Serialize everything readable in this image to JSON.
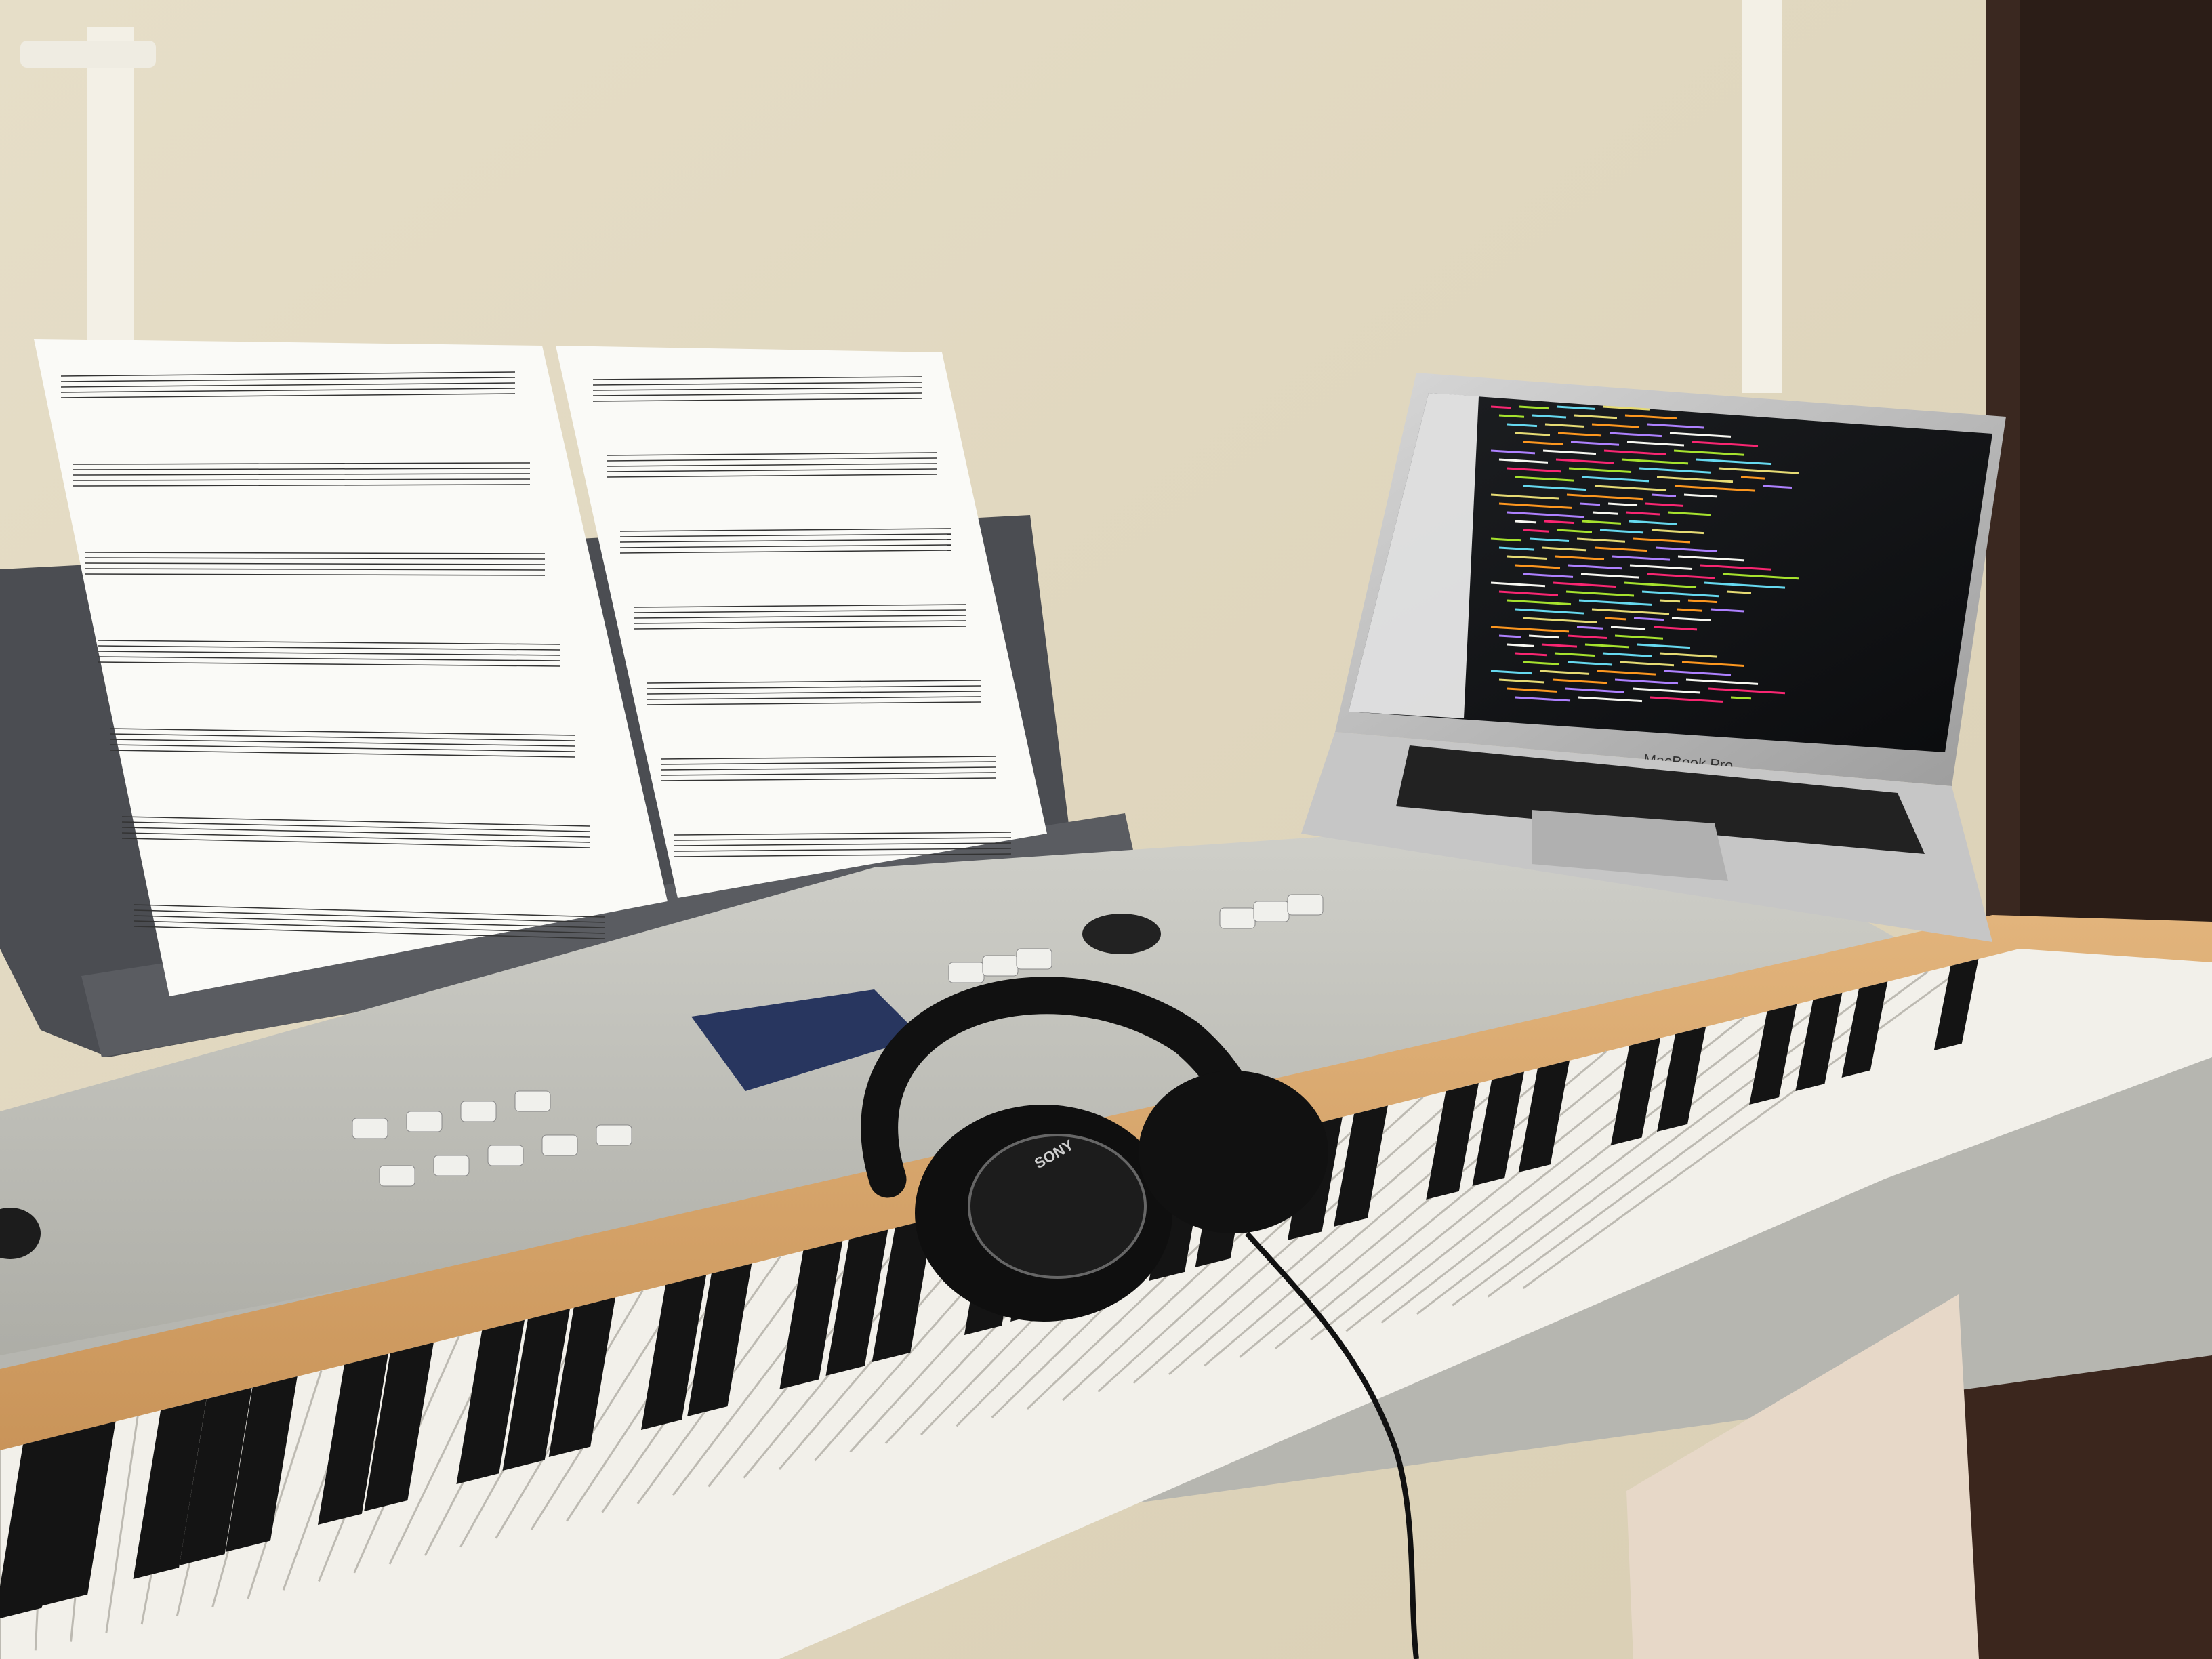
{
  "scene": {
    "laptop": {
      "brand_label": "MacBook Pro"
    },
    "headphones": {
      "brand_label": "SONY"
    }
  }
}
